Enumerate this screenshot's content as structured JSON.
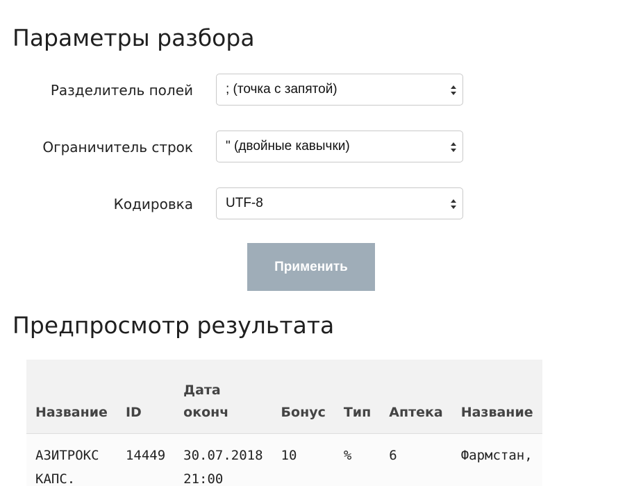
{
  "parse_settings": {
    "title": "Параметры разбора",
    "field_separator": {
      "label": "Разделитель полей",
      "value": "; (точка с запятой)"
    },
    "text_qualifier": {
      "label": "Ограничитель строк",
      "value": "\" (двойные кавычки)"
    },
    "encoding": {
      "label": "Кодировка",
      "value": "UTF-8"
    },
    "apply_label": "Применить"
  },
  "preview": {
    "title": "Предпросмотр результата",
    "columns": {
      "name": "Название",
      "id": "ID",
      "date_line1": "Дата",
      "date_line2": "оконч",
      "bonus": "Бонус",
      "type": "Тип",
      "pharmacy": "Аптека",
      "pharmacy_name": "Название"
    },
    "rows": [
      {
        "name_line1": "АЗИТРОКС",
        "name_line2": "КАПС.",
        "id": "14449",
        "date_line1": "30.07.2018",
        "date_line2": "21:00",
        "bonus": "10",
        "type": "%",
        "pharmacy": "6",
        "pharmacy_name": "Фармстан,"
      }
    ]
  },
  "icons": {
    "select_arrows": "updown-chevron-icon"
  },
  "colors": {
    "apply_button_bg": "#9fadb8",
    "table_header_bg": "#f2f2f2"
  }
}
